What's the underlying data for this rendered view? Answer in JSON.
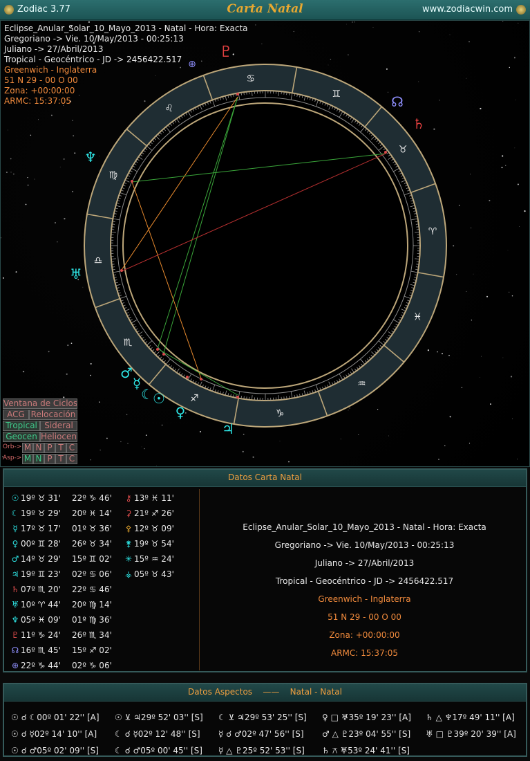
{
  "titlebar": {
    "app_name": "Zodiac 3.77",
    "title": "Carta Natal",
    "website": "www.zodiacwin.com"
  },
  "chart_info": [
    "Eclipse_Anular_Solar_10_Mayo_2013 - Natal - Hora: Exacta",
    "Gregoriano -> Vie. 10/May/2013 - 00:25:13",
    "Juliano -> 27/Abril/2013",
    "Tropical - Geocéntrico - JD -> 2456422.517",
    "Greenwich - Inglaterra",
    "51 N 29 - 00 O 00",
    "Zona: +00:00:00",
    "ARMC: 15:37:05"
  ],
  "buttons": {
    "ciclos": "Ventana de Ciclos",
    "acg": "ACG",
    "relocacion": "Relocación",
    "tropical": "Tropical",
    "sideral": "Sideral",
    "geocen": "Geocen",
    "heliocen": "Heliocen",
    "orb_label": "Orb->",
    "asp_label": "Asp->",
    "letters": [
      "M",
      "N",
      "P",
      "T",
      "C"
    ]
  },
  "planets": {
    "sun": "☉",
    "moon": "☾",
    "mercury": "☿",
    "venus": "♀",
    "mars": "♂",
    "jupiter": "♃",
    "saturn": "♄",
    "uranus": "♅",
    "neptune": "♆",
    "pluto": "♇",
    "node": "☊",
    "fortune": "⊕"
  },
  "signs": [
    "♈",
    "♉",
    "♊",
    "♋",
    "♌",
    "♍",
    "♎",
    "♏",
    "♐",
    "♑",
    "♒",
    "♓"
  ],
  "natal_panel": {
    "header": "Datos Carta Natal",
    "positions": [
      {
        "g": "☉",
        "c": "#2ee6e6",
        "a": "19º ♉ 31'",
        "b": "22º ♑ 46'",
        "g2": "⚷",
        "c2": "#e85050",
        "x": "13º ♓ 11'"
      },
      {
        "g": "☾",
        "c": "#2ee6e6",
        "a": "19º ♉ 29'",
        "b": "20º ♓ 14'",
        "g2": "⚳",
        "c2": "#e85050",
        "x": "21º ♐ 26'"
      },
      {
        "g": "☿",
        "c": "#2ee6e6",
        "a": "17º ♉ 17'",
        "b": "01º ♉ 36'",
        "g2": "⚴",
        "c2": "#e8a830",
        "x": "12º ♉ 09'"
      },
      {
        "g": "♀",
        "c": "#2ee6e6",
        "a": "00º ♊ 28'",
        "b": "26º ♉ 34'",
        "g2": "⚵",
        "c2": "#2ee6e6",
        "x": "19º ♉ 54'"
      },
      {
        "g": "♂",
        "c": "#2ee6e6",
        "a": "14º ♉ 29'",
        "b": "15º ♊ 02'",
        "g2": "✳",
        "c2": "#2ee6e6",
        "x": "15º ♒ 24'"
      },
      {
        "g": "♃",
        "c": "#2ee6e6",
        "a": "19º ♊ 23'",
        "b": "02º ♋ 06'",
        "g2": "⚶",
        "c2": "#2ee6e6",
        "x": "05º ♉ 43'"
      },
      {
        "g": "♄",
        "c": "#e85050",
        "a": "07º ♏ 20'",
        "b": "22º ♋ 46'",
        "g2": "",
        "c2": "#000",
        "x": ""
      },
      {
        "g": "♅",
        "c": "#2ee6e6",
        "a": "10º ♈ 44'",
        "b": "20º ♍ 14'",
        "g2": "",
        "c2": "#000",
        "x": ""
      },
      {
        "g": "♆",
        "c": "#2ee6e6",
        "a": "05º ♓ 09'",
        "b": "01º ♍ 36'",
        "g2": "",
        "c2": "#000",
        "x": ""
      },
      {
        "g": "♇",
        "c": "#e85050",
        "a": "11º ♑ 24'",
        "b": "26º ♏ 34'",
        "g2": "",
        "c2": "#000",
        "x": ""
      },
      {
        "g": "☊",
        "c": "#9090ff",
        "a": "16º ♏ 45'",
        "b": "15º ♐ 02'",
        "g2": "",
        "c2": "#000",
        "x": ""
      },
      {
        "g": "⊕",
        "c": "#9090ff",
        "a": "22º ♑ 44'",
        "b": "02º ♑ 06'",
        "g2": "",
        "c2": "#000",
        "x": ""
      }
    ]
  },
  "aspects_panel": {
    "header": "Datos Aspectos",
    "separator": "——",
    "subheader": "Natal - Natal",
    "rows": [
      [
        "☉ ☌ ☾00º 01' 22'' [A]",
        "☉ ⊻ ♃29º 52' 03'' [S]",
        "☾ ⊻ ♃29º 53' 25'' [S]",
        "♀ □ ♅35º 19' 23'' [A]",
        "♄ △ ♆17º 49' 11'' [A]"
      ],
      [
        "☉ ☌ ☿02º 14' 10'' [A]",
        "☾ ☌ ☿02º 12' 48'' [S]",
        "☿ ☌ ♂02º 47' 56'' [S]",
        "♂ △ ♇23º 04' 55'' [S]",
        "♅ □ ♇39º 20' 39'' [A]"
      ],
      [
        "☉ ☌ ♂05º 02' 09'' [S]",
        "☾ ☌ ♂05º 00' 45'' [S]",
        "☿ △ ♇25º 52' 53'' [S]",
        "♄ ⚻ ♅53º 24' 41'' [S]",
        ""
      ]
    ]
  }
}
